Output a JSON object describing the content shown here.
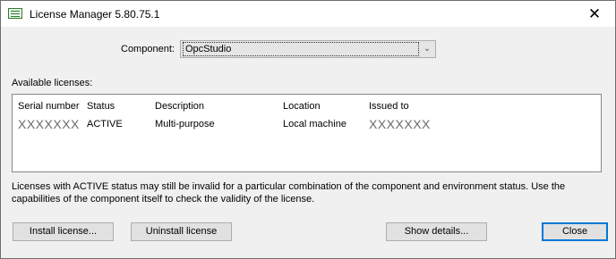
{
  "window": {
    "title": "License Manager 5.80.75.1",
    "close_glyph": "✕"
  },
  "component": {
    "label": "Component:",
    "value": "OpcStudio",
    "arrow": "⌄"
  },
  "licenses": {
    "label": "Available licenses:",
    "columns": [
      "Serial number",
      "Status",
      "Description",
      "Location",
      "Issued to"
    ],
    "rows": [
      [
        "XXXXXXX",
        "ACTIVE",
        "Multi-purpose",
        "Local machine",
        "XXXXXXX"
      ]
    ]
  },
  "note": "Licenses with ACTIVE status may still be invalid for a particular combination of the component and environment status. Use the capabilities of the component itself to check the validity of the license.",
  "buttons": {
    "install": "Install license...",
    "uninstall": "Uninstall license",
    "details": "Show details...",
    "close": "Close"
  }
}
